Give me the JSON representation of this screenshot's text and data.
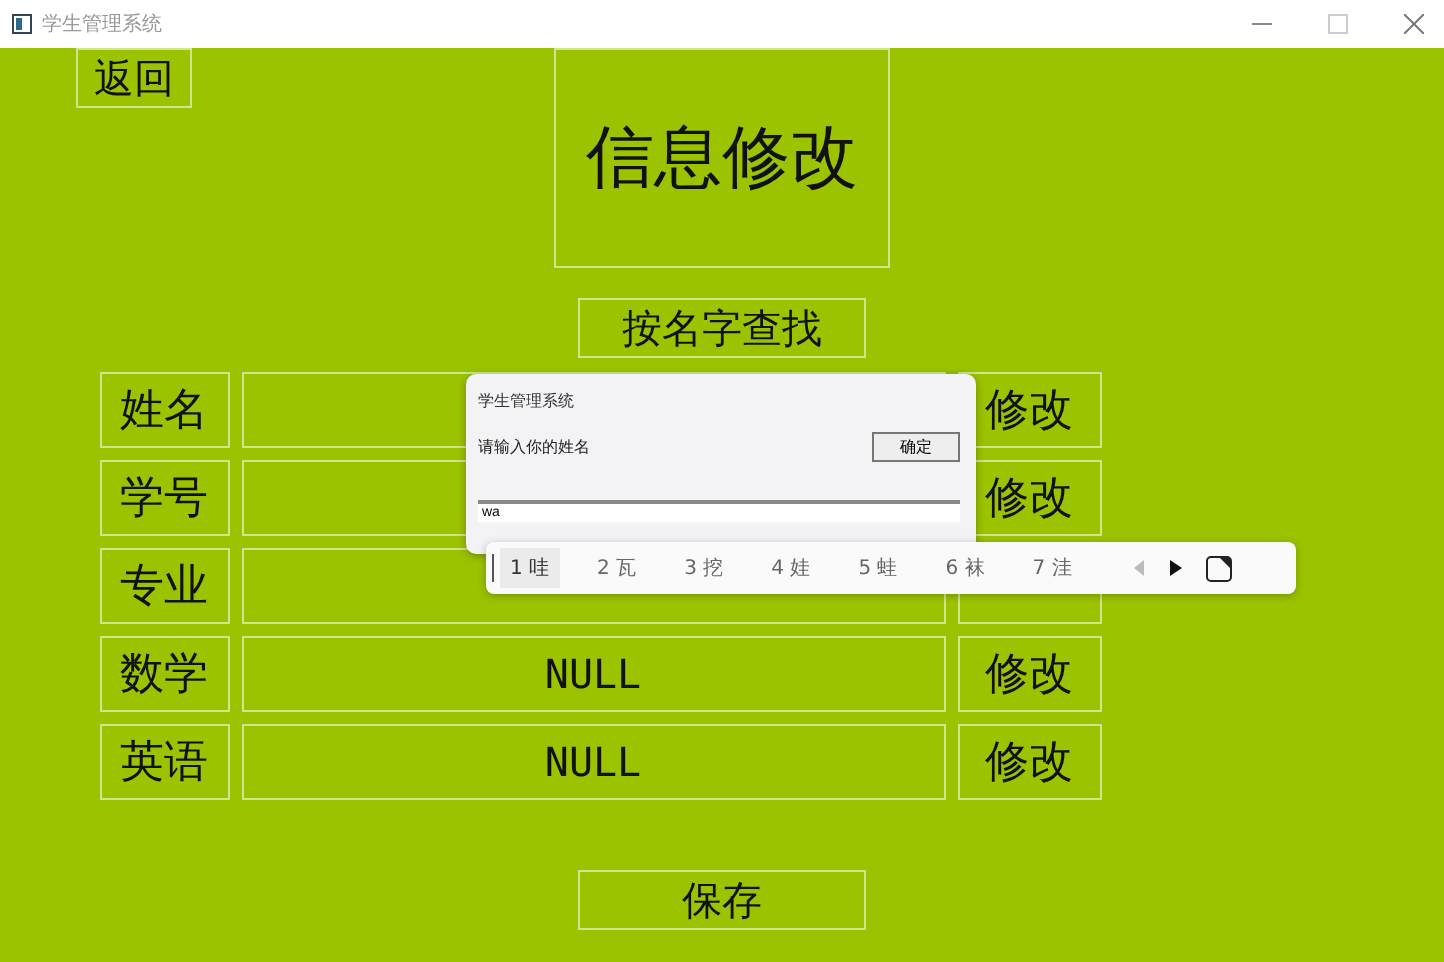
{
  "window": {
    "title": "学生管理系统"
  },
  "back_button": "返回",
  "heading": "信息修改",
  "search_button": "按名字查找",
  "fields": [
    {
      "label": "姓名",
      "edit": "修改"
    },
    {
      "label": "学号",
      "edit": "修改"
    },
    {
      "label": "专业"
    },
    {
      "label": "数学",
      "value": "NULL",
      "edit": "修改"
    },
    {
      "label": "英语",
      "value": "NULL",
      "edit": "修改"
    }
  ],
  "save_button": "保存",
  "dialog": {
    "title": "学生管理系统",
    "prompt": "请输入你的姓名",
    "ok_button": "确定",
    "input": "wa"
  },
  "ime": {
    "candidates": [
      {
        "text": "1 哇",
        "selected": true
      },
      {
        "text": "2 瓦",
        "selected": false
      },
      {
        "text": "3 挖",
        "selected": false
      },
      {
        "text": "4 娃",
        "selected": false
      },
      {
        "text": "5 蛙",
        "selected": false
      },
      {
        "text": "6 袜",
        "selected": false
      },
      {
        "text": "7 洼",
        "selected": false
      }
    ]
  }
}
